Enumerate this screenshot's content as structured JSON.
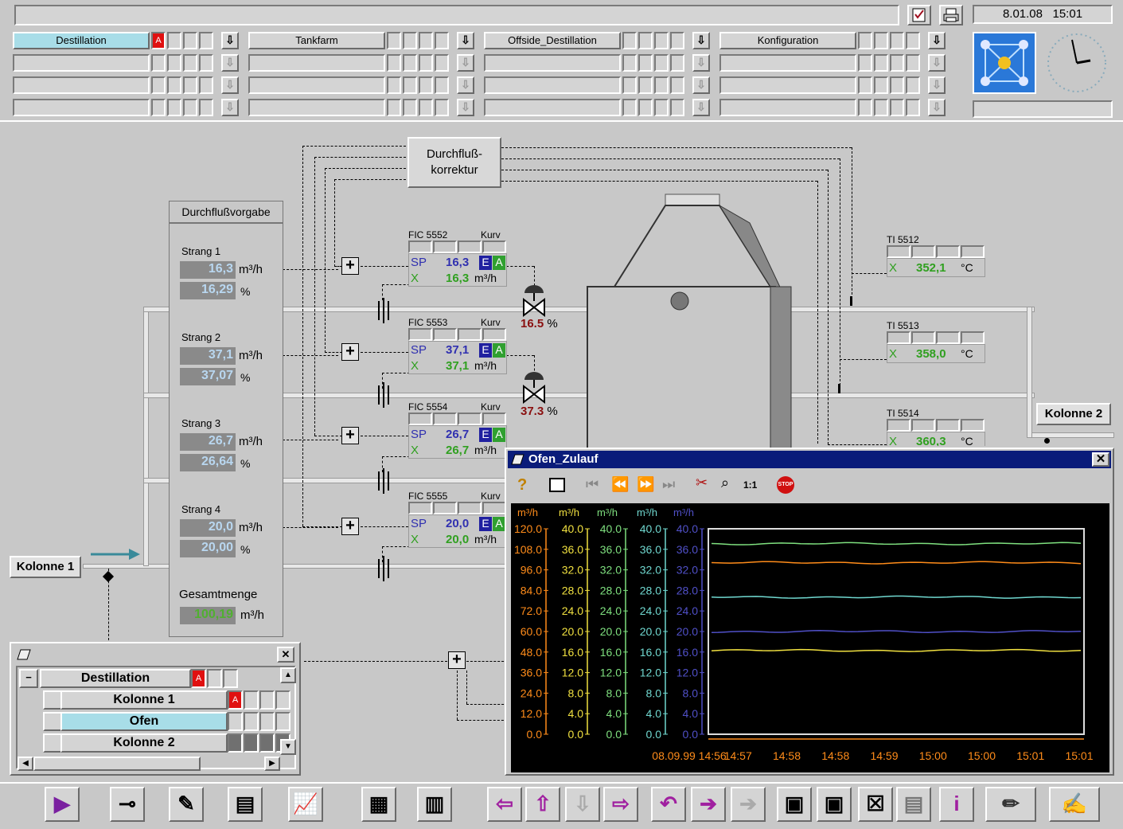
{
  "header": {
    "date": "8.01.08",
    "time": "15:01",
    "areas": [
      {
        "label": "Destillation",
        "alarm": "A",
        "active": true
      },
      {
        "label": "Tankfarm"
      },
      {
        "label": "Offside_Destillation"
      },
      {
        "label": "Konfiguration"
      }
    ]
  },
  "process": {
    "correction_box": "Durchfluß-\nkorrektur",
    "vorgabe_title": "Durchflußvorgabe",
    "strands": [
      {
        "label": "Strang 1",
        "flow": "16,3",
        "percent": "16,29"
      },
      {
        "label": "Strang 2",
        "flow": "37,1",
        "percent": "37,07"
      },
      {
        "label": "Strang 3",
        "flow": "26,7",
        "percent": "26,64"
      },
      {
        "label": "Strang 4",
        "flow": "20,0",
        "percent": "20,00"
      }
    ],
    "unit_flow": "m³/h",
    "unit_pct": "%",
    "total_label": "Gesamtmenge",
    "total_value": "100,19",
    "fics": [
      {
        "tag": "FIC 5552",
        "kurv": "Kurv",
        "sp": "16,3",
        "x": "16,3"
      },
      {
        "tag": "FIC 5553",
        "kurv": "Kurv",
        "sp": "37,1",
        "x": "37,1"
      },
      {
        "tag": "FIC 5554",
        "kurv": "Kurv",
        "sp": "26,7",
        "x": "26,7"
      },
      {
        "tag": "FIC 5555",
        "kurv": "Kurv",
        "sp": "20,0",
        "x": "20,0"
      }
    ],
    "sp_label": "SP",
    "x_label": "X",
    "e_label": "E",
    "a_label": "A",
    "valves": [
      {
        "value": "16.5",
        "unit": "%"
      },
      {
        "value": "37.3",
        "unit": "%"
      }
    ],
    "tis": [
      {
        "tag": "TI 5512",
        "value": "352,1",
        "unit": "°C"
      },
      {
        "tag": "TI 5513",
        "value": "358,0",
        "unit": "°C"
      },
      {
        "tag": "TI 5514",
        "value": "360,3",
        "unit": "°C"
      }
    ],
    "kolonne1": "Kolonne 1",
    "kolonne2": "Kolonne 2"
  },
  "tree_window": {
    "rows": [
      {
        "label": "Destillation",
        "alarm": "A",
        "toggle": "−"
      },
      {
        "label": "Kolonne 1",
        "alarm": "A"
      },
      {
        "label": "Ofen",
        "selected": true
      },
      {
        "label": "Kolonne 2"
      }
    ]
  },
  "trend_window": {
    "title": "Ofen_Zulauf",
    "zoom_label": "1:1",
    "stop_label": "STOP"
  },
  "chart_data": {
    "type": "line",
    "title": "Ofen_Zulauf",
    "axes": [
      {
        "unit": "m³/h",
        "color": "#ff8c1a",
        "ticks": [
          "120.0",
          "108.0",
          "96.0",
          "84.0",
          "72.0",
          "60.0",
          "48.0",
          "36.0",
          "24.0",
          "12.0",
          "0.0"
        ],
        "ylim": [
          0,
          120
        ]
      },
      {
        "unit": "m³/h",
        "color": "#f0e040",
        "ticks": [
          "40.0",
          "36.0",
          "32.0",
          "28.0",
          "24.0",
          "20.0",
          "16.0",
          "12.0",
          "8.0",
          "4.0",
          "0.0"
        ],
        "ylim": [
          0,
          40
        ]
      },
      {
        "unit": "m³/h",
        "color": "#7fe07f",
        "ticks": [
          "40.0",
          "36.0",
          "32.0",
          "28.0",
          "24.0",
          "20.0",
          "16.0",
          "12.0",
          "8.0",
          "4.0",
          "0.0"
        ],
        "ylim": [
          0,
          40
        ]
      },
      {
        "unit": "m³/h",
        "color": "#70d8d0",
        "ticks": [
          "40.0",
          "36.0",
          "32.0",
          "28.0",
          "24.0",
          "20.0",
          "16.0",
          "12.0",
          "8.0",
          "4.0",
          "0.0"
        ],
        "ylim": [
          0,
          40
        ]
      },
      {
        "unit": "m³/h",
        "color": "#5050c8",
        "ticks": [
          "40.0",
          "36.0",
          "32.0",
          "28.0",
          "24.0",
          "20.0",
          "16.0",
          "12.0",
          "8.0",
          "4.0",
          "0.0"
        ],
        "ylim": [
          0,
          40
        ]
      }
    ],
    "x_labels": [
      "08.09.99 14:56",
      "14:57",
      "14:58",
      "14:58",
      "14:59",
      "15:00",
      "15:00",
      "15:01",
      "15:01"
    ],
    "series": [
      {
        "color": "#7fe07f",
        "scale": 40,
        "value": 37.1
      },
      {
        "color": "#ff8c1a",
        "scale": 120,
        "value": 100.19
      },
      {
        "color": "#70d8d0",
        "scale": 40,
        "value": 26.7
      },
      {
        "color": "#5050c8",
        "scale": 40,
        "value": 20.0
      },
      {
        "color": "#f0e040",
        "scale": 40,
        "value": 16.3
      }
    ],
    "grid": false
  },
  "toolbar": {
    "icons": [
      "play-icon",
      "key-icon",
      "notepad-icon",
      "print-list-icon",
      "trend-icon",
      "screen-print-icon",
      "screen-p-icon",
      "arrow-left-icon",
      "arrow-up-icon",
      "arrow-down-icon",
      "arrow-right-icon",
      "undo-icon",
      "goto-icon",
      "goto-disabled-icon",
      "window-icon",
      "window-back-icon",
      "close-window-icon",
      "list-icon",
      "info-icon",
      "pencil-icon",
      "signature-icon"
    ]
  }
}
